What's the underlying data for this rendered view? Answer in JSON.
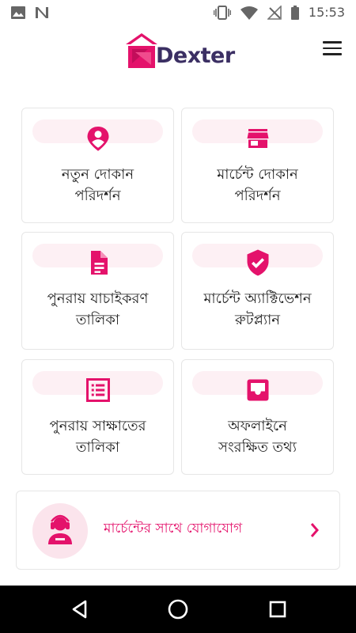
{
  "status_bar": {
    "time": "15:53",
    "left_icons": [
      "image-icon",
      "n-app-icon"
    ],
    "right_icons": [
      "vibrate-icon",
      "wifi-icon",
      "no-signal-icon",
      "battery-icon"
    ]
  },
  "app_bar": {
    "logo_text": "Dexter",
    "menu_icon": "hamburger-menu-icon"
  },
  "colors": {
    "accent": "#e4126b",
    "pill": "#fdf0f4",
    "logo_text": "#3b2f63"
  },
  "menu_cards": [
    {
      "icon": "person-pin-icon",
      "line1": "নতুন দোকান",
      "line2": "পরিদর্শন"
    },
    {
      "icon": "store-icon",
      "line1": "মার্চেন্ট দোকান",
      "line2": "পরিদর্শন"
    },
    {
      "icon": "document-icon",
      "line1": "পুনরায় যাচাইকরণ",
      "line2": "তালিকা"
    },
    {
      "icon": "verified-shield-icon",
      "line1": "মার্চেন্ট অ্যাক্টিভেশন",
      "line2": "রুটপ্ল্যান"
    },
    {
      "icon": "list-icon",
      "line1": "পুনরায় সাক্ষাতের",
      "line2": "তালিকা"
    },
    {
      "icon": "offline-inbox-icon",
      "line1": "অফলাইনে",
      "line2": "সংরক্ষিত তথ্য"
    }
  ],
  "contact": {
    "label": "মার্চেন্টের সাথে যোগাযোগ",
    "icon": "support-agent-icon"
  },
  "nav_bar": {
    "icons": [
      "back-icon",
      "home-icon",
      "recents-icon"
    ]
  }
}
